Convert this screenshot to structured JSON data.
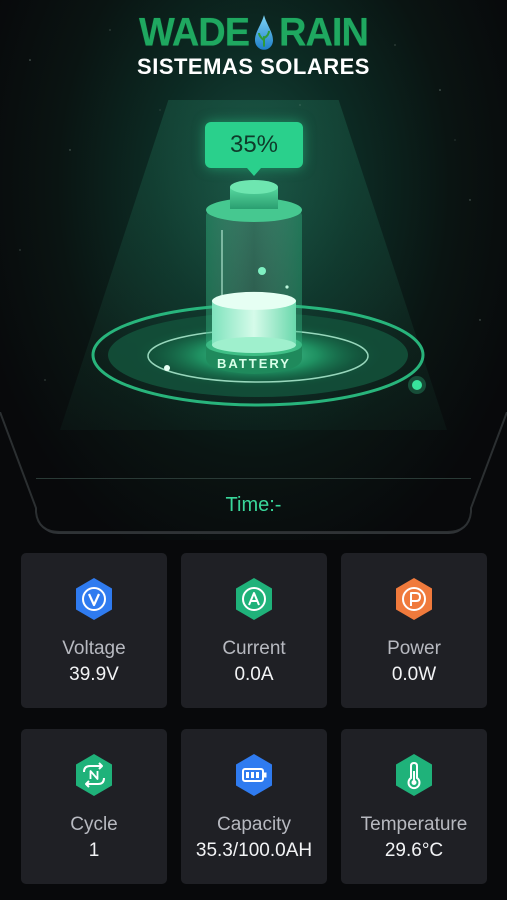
{
  "logo": {
    "brand_left": "WADE",
    "brand_right": "RAIN",
    "subtitle": "SISTEMAS SOLARES"
  },
  "battery": {
    "percent_label": "35%",
    "percent": 35,
    "base_label": "BATTERY",
    "time_label": "Time:-"
  },
  "colors": {
    "accent": "#2ad08c",
    "voltage": "#2f7bf0",
    "current": "#1fb27a",
    "power": "#f07a3c",
    "capacity": "#2f7bf0",
    "temperature": "#1fb27a",
    "card_bg": "#1f2025"
  },
  "stats": [
    {
      "label": "Voltage",
      "value": "39.9V",
      "icon": "voltage-icon"
    },
    {
      "label": "Current",
      "value": "0.0A",
      "icon": "current-icon"
    },
    {
      "label": "Power",
      "value": "0.0W",
      "icon": "power-icon"
    },
    {
      "label": "Cycle",
      "value": "1",
      "icon": "cycle-icon"
    },
    {
      "label": "Capacity",
      "value": "35.3/100.0AH",
      "icon": "capacity-icon"
    },
    {
      "label": "Temperature",
      "value": "29.6°C",
      "icon": "thermometer-icon"
    }
  ],
  "icon_letters": {
    "voltage": "V",
    "current": "A",
    "power": "P",
    "cycle": "N"
  }
}
